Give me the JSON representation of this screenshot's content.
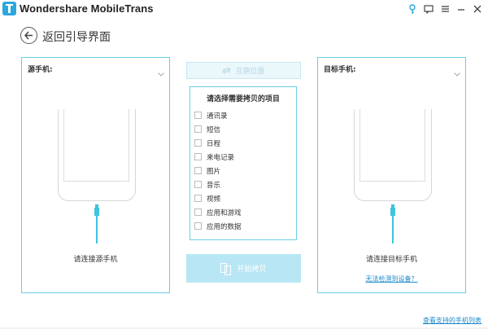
{
  "app": {
    "title": "Wondershare MobileTrans"
  },
  "header": {
    "back_label": "返回引导界面"
  },
  "source": {
    "title": "源手机:",
    "message": "请连接源手机"
  },
  "target": {
    "title": "目标手机:",
    "message": "请连接目标手机",
    "link": "无法检测到设备？"
  },
  "center": {
    "swap_label": "互换位置",
    "items_title": "请选择需要拷贝的项目",
    "items": [
      {
        "label": "通讯录"
      },
      {
        "label": "短信"
      },
      {
        "label": "日程"
      },
      {
        "label": "来电记录"
      },
      {
        "label": "图片"
      },
      {
        "label": "音乐"
      },
      {
        "label": "视频"
      },
      {
        "label": "应用和游戏"
      },
      {
        "label": "应用的数据"
      }
    ],
    "start_label": "开始拷贝"
  },
  "footer": {
    "link": "查看支持的手机列表"
  },
  "colors": {
    "accent": "#6ccde4",
    "brand": "#2aa7dc",
    "cable": "#3ec3e0",
    "link": "#1a88c8",
    "button_disabled": "#b8e6f4"
  }
}
